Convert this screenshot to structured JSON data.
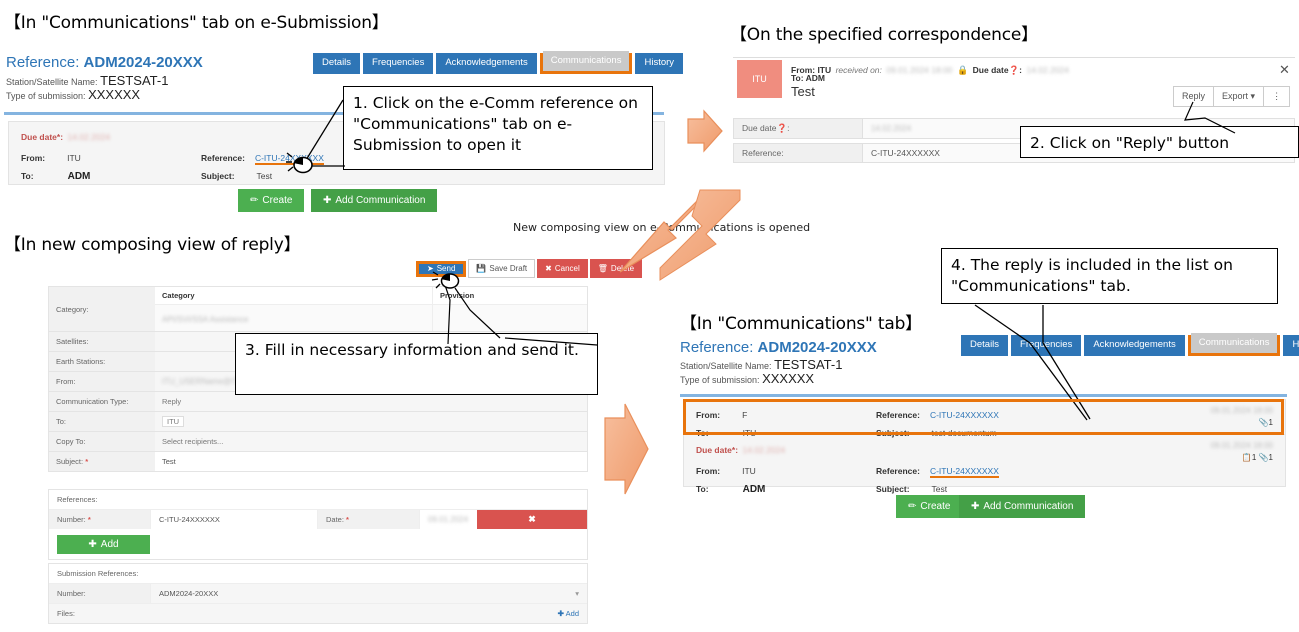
{
  "sections": {
    "s1_title": "【In \"Communications\" tab on e-Submission】",
    "s2_title": "【On the specified correspondence】",
    "s3_title": "【In new composing view of reply】",
    "s4_title": "【In \"Communications\" tab】"
  },
  "center_note": "New composing view on e-Communications is opened",
  "callouts": {
    "step1": "1. Click on the e-Comm reference on \"Communications\" tab on e-Submission to open it",
    "step2": "2. Click on \"Reply\" button",
    "step3": "3. Fill in necessary information and send it.",
    "step4": "4. The reply is included in the list on \"Communications\" tab."
  },
  "esub": {
    "reference_label": "Reference:",
    "reference_value": "ADM2024-20XXX",
    "station_label": "Station/Satellite Name:",
    "station_value": "TESTSAT-1",
    "type_label": "Type of submission:",
    "type_value": "XXXXXX",
    "tabs": [
      {
        "label": "Details",
        "active": false
      },
      {
        "label": "Frequencies",
        "active": false
      },
      {
        "label": "Acknowledgements",
        "active": false
      },
      {
        "label": "Communications",
        "active": true
      },
      {
        "label": "History",
        "active": false
      }
    ],
    "rows": [
      {
        "due_label": "Due date*:",
        "due_value": "14.02.2024",
        "from_label": "From:",
        "from_value": "ITU",
        "to_label": "To:",
        "to_value": "ADM",
        "ref_label": "Reference:",
        "ref_value": "C-ITU-24XXXXXX",
        "subj_label": "Subject:",
        "subj_value": "Test"
      }
    ],
    "buttons": {
      "create": "Create",
      "add_communication": "Add Communication"
    }
  },
  "correspondence": {
    "avatar": "ITU",
    "from_label": "From: ITU",
    "received_label": "received on:",
    "received_value": "09.01.2024 18:00",
    "duedate_label": "Due date",
    "duedate_value": "14.02.2024",
    "to_label": "To: ADM",
    "subject": "Test",
    "close_icon": "close-icon",
    "lock_icon": "lock-icon",
    "help_icon": "help-icon",
    "buttons": {
      "reply": "Reply",
      "export": "Export",
      "more": "⋮"
    },
    "meta": [
      {
        "key": "Due date",
        "value": "14.02.2024",
        "blurred": true
      },
      {
        "key": "Reference:",
        "value": "C-ITU-24XXXXXX",
        "blurred": false
      }
    ]
  },
  "compose": {
    "toolbar": [
      {
        "label": "Send",
        "icon": "send-icon",
        "style": "blue",
        "highlighted": true
      },
      {
        "label": "Save Draft",
        "icon": "save-icon",
        "style": "white",
        "highlighted": false
      },
      {
        "label": "Cancel",
        "icon": "cancel-icon",
        "style": "red",
        "highlighted": false
      },
      {
        "label": "Delete",
        "icon": "trash-icon",
        "style": "red",
        "highlighted": false
      }
    ],
    "category_header_left": "Category",
    "category_header_right": "Provision",
    "category_value": "API/SVI/SSA Assistance",
    "fields": [
      {
        "key": "Category:",
        "value": "",
        "blurred": false
      },
      {
        "key": "Satellites:",
        "value": "",
        "blurred": false
      },
      {
        "key": "Earth Stations:",
        "value": "",
        "blurred": false
      },
      {
        "key": "From:",
        "value": "ITU_USERName@ITU",
        "blurred": true
      },
      {
        "key": "Communication Type:",
        "value": "Reply",
        "blurred": false
      },
      {
        "key": "To:",
        "value": "ITU",
        "blurred": false
      },
      {
        "key": "Copy To:",
        "value": "Select recipients...",
        "blurred": false
      },
      {
        "key": "Subject:",
        "value": "Test",
        "blurred": false,
        "required": true
      }
    ],
    "references": {
      "title": "References:",
      "number_label": "Number:",
      "number_value": "C-ITU-24XXXXXX",
      "date_label": "Date:",
      "date_value": "09.01.2024",
      "remove_icon": "close-icon",
      "add_label": "Add"
    },
    "submission_references": {
      "title": "Submission References:",
      "number_label": "Number:",
      "number_value": "ADM2024-20XXX",
      "files_label": "Files:",
      "files_add_label": "Add"
    }
  },
  "result": {
    "reference_label": "Reference:",
    "reference_value": "ADM2024-20XXX",
    "station_label": "Station/Satellite Name:",
    "station_value": "TESTSAT-1",
    "type_label": "Type of submission:",
    "type_value": "XXXXXX",
    "tabs": [
      {
        "label": "Details",
        "active": false
      },
      {
        "label": "Frequencies",
        "active": false
      },
      {
        "label": "Acknowledgements",
        "active": false
      },
      {
        "label": "Communications",
        "active": true
      },
      {
        "label": "History",
        "active": false
      }
    ],
    "rows": [
      {
        "highlighted": true,
        "due_label": "",
        "due_value": "",
        "from_label": "From:",
        "from_value": "F",
        "to_label": "To:",
        "to_value": "ITU",
        "ref_label": "Reference:",
        "ref_value": "C-ITU-24XXXXXX",
        "subj_label": "Subject:",
        "subj_value": "test documentum",
        "timestamp": "09.01.2024 18:00",
        "attachment_count": "1",
        "doc_count": ""
      },
      {
        "highlighted": false,
        "due_label": "Due date*:",
        "due_value": "14.02.2024",
        "from_label": "From:",
        "from_value": "ITU",
        "to_label": "To:",
        "to_value": "ADM",
        "ref_label": "Reference:",
        "ref_value": "C-ITU-24XXXXXX",
        "subj_label": "Subject:",
        "subj_value": "Test",
        "timestamp": "09.01.2024 18:00",
        "attachment_count": "1",
        "doc_count": "1"
      }
    ],
    "buttons": {
      "create": "Create",
      "add_communication": "Add Communication"
    }
  },
  "colors": {
    "tab_blue": "#2e75b6",
    "tab_active_grey": "#c9c9c9",
    "highlight_orange": "#e8740c",
    "green_button": "#4caf50",
    "red_button": "#d9534f",
    "avatar_salmon": "#f08d7f",
    "arrow_orange": "#f4a97f",
    "due_red": "#c0504d"
  }
}
